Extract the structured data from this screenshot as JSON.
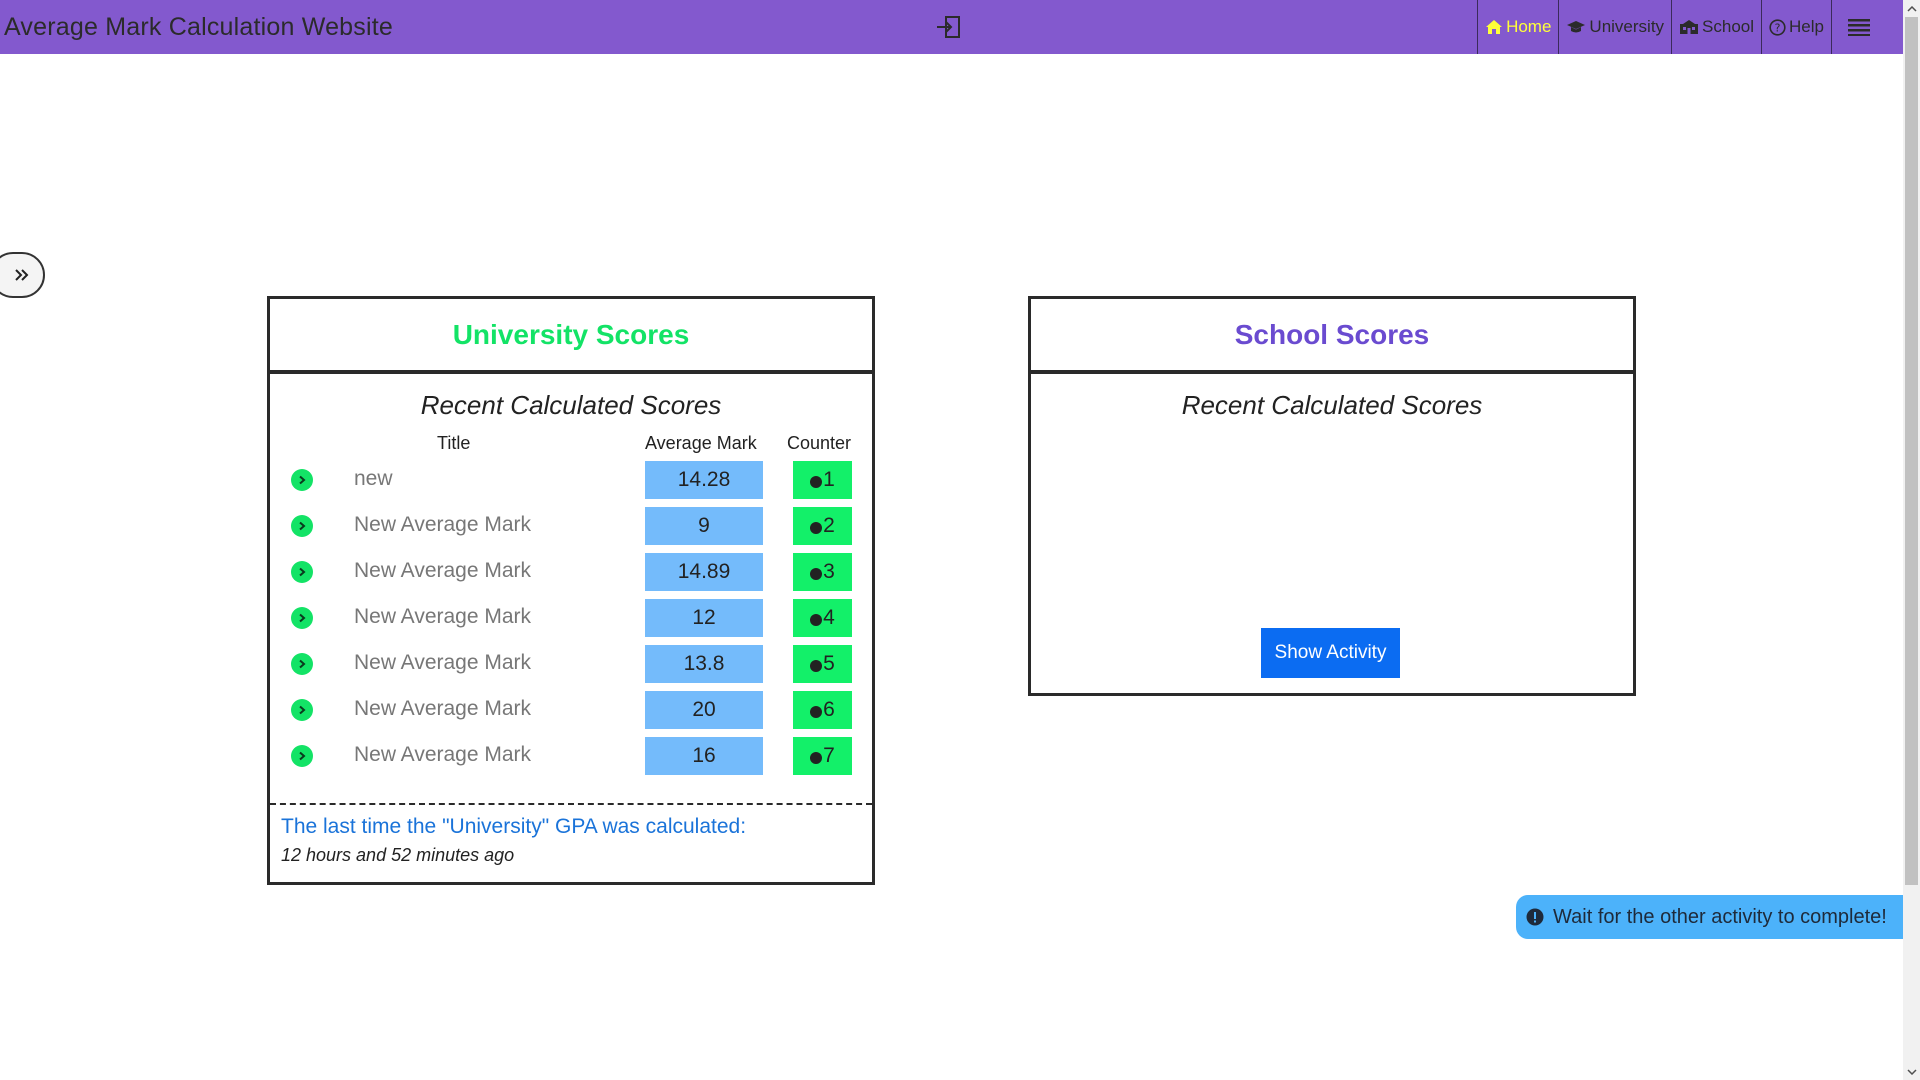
{
  "navbar": {
    "brand": "Average Mark Calculation Website",
    "links": [
      {
        "label": "Home",
        "icon": "home-icon",
        "active": true
      },
      {
        "label": "University",
        "icon": "graduation-cap-icon",
        "active": false
      },
      {
        "label": "School",
        "icon": "school-icon",
        "active": false
      },
      {
        "label": "Help",
        "icon": "help-circle-icon",
        "active": false
      }
    ],
    "active_color": "#ffff3a",
    "background": "#8359ce"
  },
  "university": {
    "title": "University Scores",
    "subtitle": "Recent Calculated Scores",
    "headers": {
      "title": "Title",
      "mark": "Average Mark",
      "counter": "Counter"
    },
    "rows": [
      {
        "title": "new",
        "mark": "14.28",
        "counter": "1"
      },
      {
        "title": "New Average Mark",
        "mark": "9",
        "counter": "2"
      },
      {
        "title": "New Average Mark",
        "mark": "14.89",
        "counter": "3"
      },
      {
        "title": "New Average Mark",
        "mark": "12",
        "counter": "4"
      },
      {
        "title": "New Average Mark",
        "mark": "13.8",
        "counter": "5"
      },
      {
        "title": "New Average Mark",
        "mark": "20",
        "counter": "6"
      },
      {
        "title": "New Average Mark",
        "mark": "16",
        "counter": "7"
      }
    ],
    "footer_label": "The last time the \"University\" GPA was calculated:",
    "footer_time": "12 hours and 52 minutes ago"
  },
  "school": {
    "title": "School Scores",
    "subtitle": "Recent Calculated Scores",
    "button_label": "Show Activity"
  },
  "toast": {
    "message": "Wait for the other activity to complete!"
  }
}
